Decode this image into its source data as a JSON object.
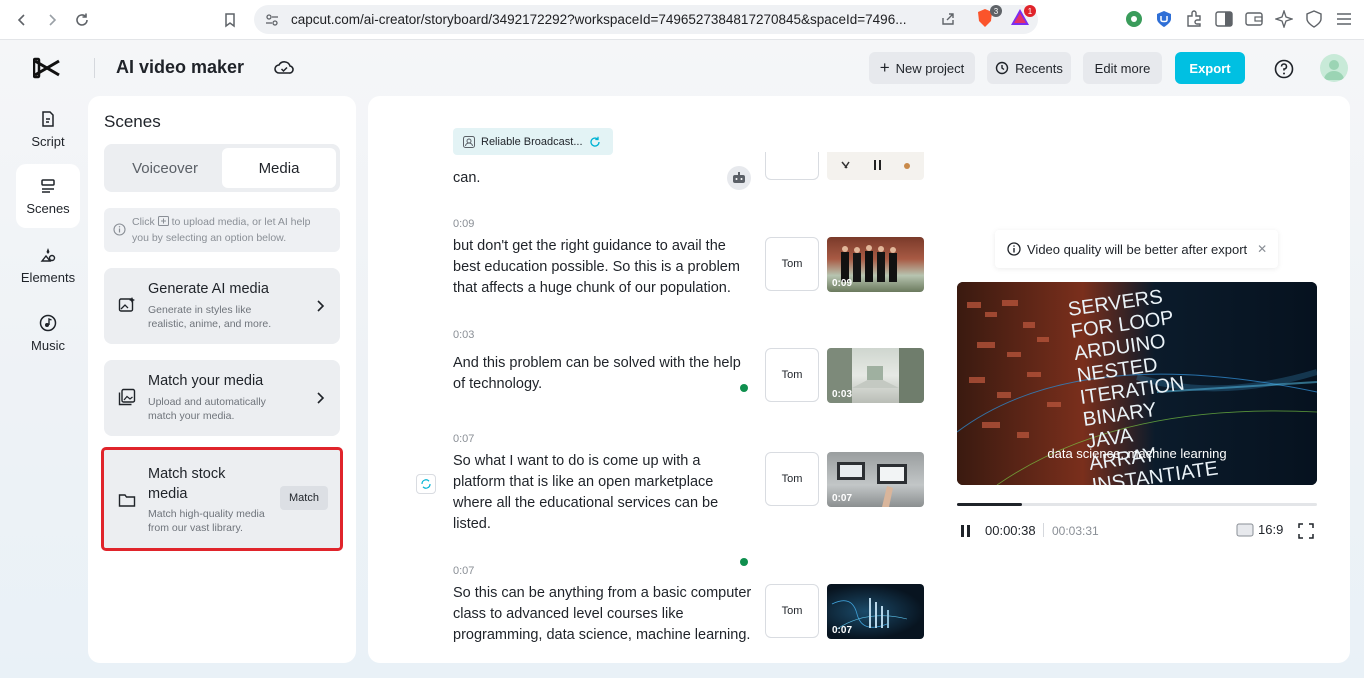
{
  "browser": {
    "url": "capcut.com/ai-creator/storyboard/3492172292?workspaceId=7496527384817270845&spaceId=7496...",
    "brave_badge": "3",
    "alert_badge": "1"
  },
  "header": {
    "title": "AI video maker",
    "new_project": "New project",
    "recents": "Recents",
    "edit_more": "Edit more",
    "export": "Export"
  },
  "rail": {
    "script": "Script",
    "scenes": "Scenes",
    "elements": "Elements",
    "music": "Music"
  },
  "scenes_panel": {
    "title": "Scenes",
    "tab_voiceover": "Voiceover",
    "tab_media": "Media",
    "hint_part1": "Click",
    "hint_part2": "to upload media, or let AI help you by selecting an option below.",
    "generate": {
      "title": "Generate AI media",
      "desc": "Generate in styles like realistic, anime, and more."
    },
    "match_yours": {
      "title": "Match your media",
      "desc": "Upload and automatically match your media."
    },
    "match_stock": {
      "title": "Match stock media",
      "desc": "Match high-quality media from our vast library.",
      "button": "Match"
    }
  },
  "storyboard": {
    "voice_chip": "Reliable Broadcast...",
    "partial_text": "can.",
    "scenes": [
      {
        "time": "0:09",
        "text": "but don't get the right guidance to avail the best education possible. So this is a problem that affects a huge chunk of our population.",
        "speaker": "Tom",
        "duration": "0:09"
      },
      {
        "time": "0:03",
        "text": "And this problem can be solved with the help of technology.",
        "speaker": "Tom",
        "duration": "0:03"
      },
      {
        "time": "0:07",
        "text": "So what I want to do is come up with a platform that is like an open marketplace where all the educational services can be listed.",
        "speaker": "Tom",
        "duration": "0:07"
      },
      {
        "time": "0:07",
        "text": "So this can be anything from a basic computer class to advanced level courses like programming, data science, machine learning.",
        "speaker": "Tom",
        "duration": "0:07"
      }
    ]
  },
  "preview": {
    "quality_note": "Video quality will be better after export",
    "caption": "data science, machine learning",
    "current_time": "00:00:38",
    "total_time": "00:03:31",
    "progress_fraction": 0.18,
    "ratio": "16:9",
    "video_words": [
      "SERVERS",
      "FOR LOOP",
      "ARDUINO",
      "NESTED",
      "ITERATION",
      "BINARY",
      "JAVA",
      "ARRAY",
      "INSTANTIATE"
    ]
  },
  "colors": {
    "accent": "#00c0e2",
    "highlight": "#e0242b",
    "status_green": "#0f8f4e"
  }
}
